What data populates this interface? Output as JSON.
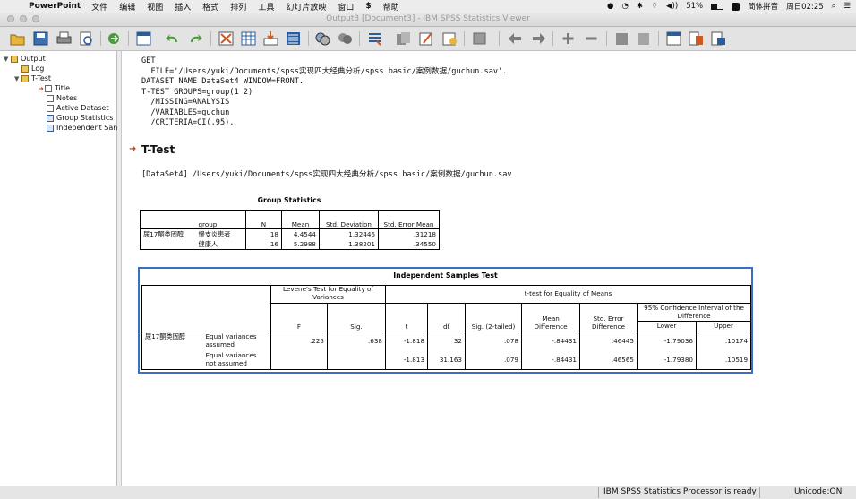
{
  "menubar": {
    "app_name": "PowerPoint",
    "items": [
      "文件",
      "编辑",
      "视图",
      "插入",
      "格式",
      "排列",
      "工具",
      "幻灯片放映",
      "窗口",
      "帮助"
    ],
    "battery": "51%",
    "input_method": "简体拼音",
    "clock": "周日02:25"
  },
  "window": {
    "title": "Output3 [Document3] - IBM SPSS Statistics Viewer"
  },
  "toolbar": {
    "buttons": [
      "open-icon",
      "save-icon",
      "print-icon",
      "print-preview-icon",
      "export-icon",
      "recall-dialog-icon",
      "undo-icon",
      "redo-icon",
      "goto-case-icon",
      "goto-variable-icon",
      "insert-variable-icon",
      "variables-icon",
      "show-all-variables-icon",
      "spellcheck-icon",
      "select-cases-icon",
      "use-sets-icon",
      "weight-icon",
      "split-file-icon",
      "stop-icon",
      "previous-icon",
      "next-icon",
      "expand-icon",
      "collapse-icon",
      "show-icon",
      "hide-icon",
      "insert-heading-icon",
      "insert-title-icon",
      "insert-text-icon"
    ]
  },
  "outline": {
    "root": "Output",
    "log": "Log",
    "ttest": "T-Test",
    "children": [
      "Title",
      "Notes",
      "Active Dataset",
      "Group Statistics",
      "Independent San"
    ]
  },
  "syntax": {
    "lines": [
      "GET",
      "  FILE='/Users/yuki/Documents/spss实现四大经典分析/spss basic/案例数据/guchun.sav'.",
      "DATASET NAME DataSet4 WINDOW=FRONT.",
      "T-TEST GROUPS=group(1 2)",
      "  /MISSING=ANALYSIS",
      "  /VARIABLES=guchun",
      "  /CRITERIA=CI(.95)."
    ]
  },
  "section_title": "T-Test",
  "dataset_line": "[DataSet4] /Users/yuki/Documents/spss实现四大经典分析/spss basic/案例数据/guchun.sav",
  "group_stats": {
    "caption": "Group Statistics",
    "headers": {
      "group": "group",
      "n": "N",
      "mean": "Mean",
      "sd": "Std. Deviation",
      "se": "Std. Error Mean"
    },
    "variable": "尿17酮类固醇",
    "rows": [
      {
        "group": "慢支炎患者",
        "n": "18",
        "mean": "4.4544",
        "sd": "1.32446",
        "se": ".31218"
      },
      {
        "group": "健康人",
        "n": "16",
        "mean": "5.2988",
        "sd": "1.38201",
        "se": ".34550"
      }
    ]
  },
  "ind_test": {
    "caption": "Independent Samples Test",
    "levene": "Levene's Test for Equality of Variances",
    "ttest": "t-test for Equality of Means",
    "ci": "95% Confidence Interval of the Difference",
    "headers": {
      "f": "F",
      "sig": "Sig.",
      "t": "t",
      "df": "df",
      "sig2": "Sig. (2-tailed)",
      "md": "Mean Difference",
      "sed": "Std. Error Difference",
      "lower": "Lower",
      "upper": "Upper"
    },
    "variable": "尿17酮类固醇",
    "rows": [
      {
        "label": "Equal variances assumed",
        "f": ".225",
        "sig": ".638",
        "t": "-1.818",
        "df": "32",
        "sig2": ".078",
        "md": "-.84431",
        "sed": ".46445",
        "lower": "-1.79036",
        "upper": ".10174"
      },
      {
        "label": "Equal variances not assumed",
        "f": "",
        "sig": "",
        "t": "-1.813",
        "df": "31.163",
        "sig2": ".079",
        "md": "-.84431",
        "sed": ".46565",
        "lower": "-1.79380",
        "upper": ".10519"
      }
    ]
  },
  "status": {
    "processor": "IBM SPSS Statistics Processor is ready",
    "unicode": "Unicode:ON"
  },
  "colors": {
    "selection_border": "#3a6fc4",
    "section_arrow": "#d23a16"
  }
}
